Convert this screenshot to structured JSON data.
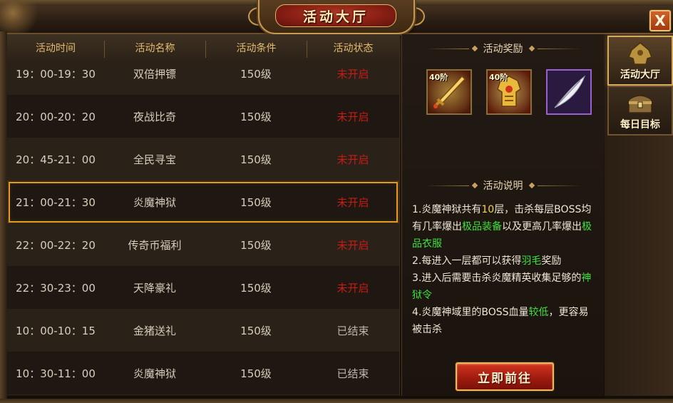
{
  "window": {
    "title": "活动大厅",
    "close_label": "X"
  },
  "table": {
    "headers": [
      "活动时间",
      "活动名称",
      "活动条件",
      "活动状态"
    ],
    "rows": [
      {
        "time": "19：00-19：30",
        "name": "双倍押镖",
        "condition": "150级",
        "status": "未开启",
        "status_type": "closed"
      },
      {
        "time": "20：00-20：20",
        "name": "夜战比奇",
        "condition": "150级",
        "status": "未开启",
        "status_type": "closed"
      },
      {
        "time": "20：45-21：00",
        "name": "全民寻宝",
        "condition": "150级",
        "status": "未开启",
        "status_type": "closed"
      },
      {
        "time": "21：00-21：30",
        "name": "炎魔神狱",
        "condition": "150级",
        "status": "未开启",
        "status_type": "closed",
        "selected": true
      },
      {
        "time": "22：00-22：20",
        "name": "传奇币福利",
        "condition": "150级",
        "status": "未开启",
        "status_type": "closed"
      },
      {
        "time": "22：30-23：00",
        "name": "天降豪礼",
        "condition": "150级",
        "status": "未开启",
        "status_type": "closed"
      },
      {
        "time": "10：00-10：15",
        "name": "金猪送礼",
        "condition": "150级",
        "status": "已结束",
        "status_type": "ended"
      },
      {
        "time": "10：30-11：00",
        "name": "炎魔神狱",
        "condition": "150级",
        "status": "已结束",
        "status_type": "ended"
      }
    ]
  },
  "detail": {
    "reward_title": "活动奖励",
    "rewards": [
      {
        "icon": "golden-sword-icon",
        "badge": "40阶"
      },
      {
        "icon": "golden-armor-icon",
        "badge": "40阶"
      },
      {
        "icon": "white-feather-icon",
        "badge": ""
      }
    ],
    "desc_title": "活动说明",
    "description": [
      [
        {
          "t": "1.炎魔神狱共有"
        },
        {
          "t": "10",
          "c": "y"
        },
        {
          "t": "层，击杀每层BOSS均有几率爆出"
        },
        {
          "t": "极品装备",
          "c": "g"
        },
        {
          "t": "以及更高几率爆出"
        },
        {
          "t": "极品衣服",
          "c": "g"
        }
      ],
      [
        {
          "t": "2.每进入一层都可以获得"
        },
        {
          "t": "羽毛",
          "c": "g"
        },
        {
          "t": "奖励"
        }
      ],
      [
        {
          "t": "3.进入后需要击杀炎魔精英收集足够的"
        },
        {
          "t": "神狱令",
          "c": "g"
        }
      ],
      [
        {
          "t": "4.炎魔神域里的BOSS血量"
        },
        {
          "t": "较低",
          "c": "g"
        },
        {
          "t": "，更容易被击杀"
        }
      ]
    ],
    "go_button": "立即前往"
  },
  "side_tabs": [
    {
      "label": "活动大厅",
      "icon": "armor-helmet-icon",
      "active": true
    },
    {
      "label": "每日目标",
      "icon": "treasure-chest-icon",
      "active": false
    }
  ],
  "colors": {
    "status_closed": "#c71c14",
    "status_ended": "#bdb6aa",
    "highlight_yellow": "#f3d34a",
    "highlight_green": "#3ee03e",
    "selection": "#e39b1f"
  }
}
